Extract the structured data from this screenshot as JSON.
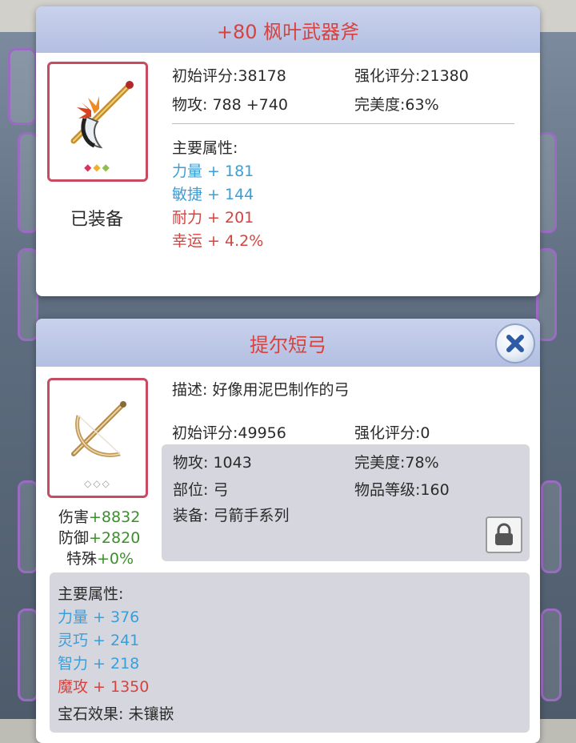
{
  "top_panel": {
    "title": "+80 枫叶武器斧",
    "status": "已装备",
    "gems": "◆◆◆",
    "initial_score_label": "初始评分:",
    "initial_score": "38178",
    "enhance_score_label": "强化评分:",
    "enhance_score": "21380",
    "attack_label": "物攻:",
    "attack": "788 +740",
    "perfection_label": "完美度:",
    "perfection": "63%",
    "attr_header": "主要属性:",
    "attrs": [
      {
        "text": "力量 + 181",
        "color": "blue"
      },
      {
        "text": "敏捷 + 144",
        "color": "blue"
      },
      {
        "text": "耐力 + 201",
        "color": "red"
      },
      {
        "text": "幸运 + 4.2%",
        "color": "red"
      }
    ]
  },
  "bottom_panel": {
    "title": "提尔短弓",
    "gems": "◇◇◇",
    "desc_label": "描述:",
    "desc": "好像用泥巴制作的弓",
    "initial_score_label": "初始评分:",
    "initial_score": "49956",
    "enhance_score_label": "强化评分:",
    "enhance_score": "0",
    "attack_label": "物攻:",
    "attack": "1043",
    "perfection_label": "完美度:",
    "perfection": "78%",
    "slot_label": "部位:",
    "slot": "弓",
    "item_level_label": "物品等级:",
    "item_level": "160",
    "equip_label": "装备:",
    "equip": "弓箭手系列",
    "compare": [
      {
        "label": "伤害",
        "value": "+8832"
      },
      {
        "label": "防御",
        "value": "+2820"
      },
      {
        "label": "特殊",
        "value": "+0%"
      }
    ],
    "attr_header": "主要属性:",
    "attrs": [
      {
        "text": "力量 + 376",
        "color": "blue"
      },
      {
        "text": "灵巧 + 241",
        "color": "blue"
      },
      {
        "text": "智力 + 218",
        "color": "blue"
      },
      {
        "text": "魔攻 + 1350",
        "color": "red"
      }
    ],
    "gem_effect_label": "宝石效果:",
    "gem_effect": "未镶嵌"
  },
  "icons": {
    "axe": "axe-icon",
    "crossbow": "crossbow-icon",
    "lock": "lock-icon",
    "close": "close-icon"
  },
  "colors": {
    "title_red": "#d8423e",
    "attr_blue": "#3a9fd8",
    "attr_red": "#d8423e",
    "compare_green": "#3c8f2c",
    "header_bg": "#c0cbea",
    "frame_border": "#c94b62"
  }
}
